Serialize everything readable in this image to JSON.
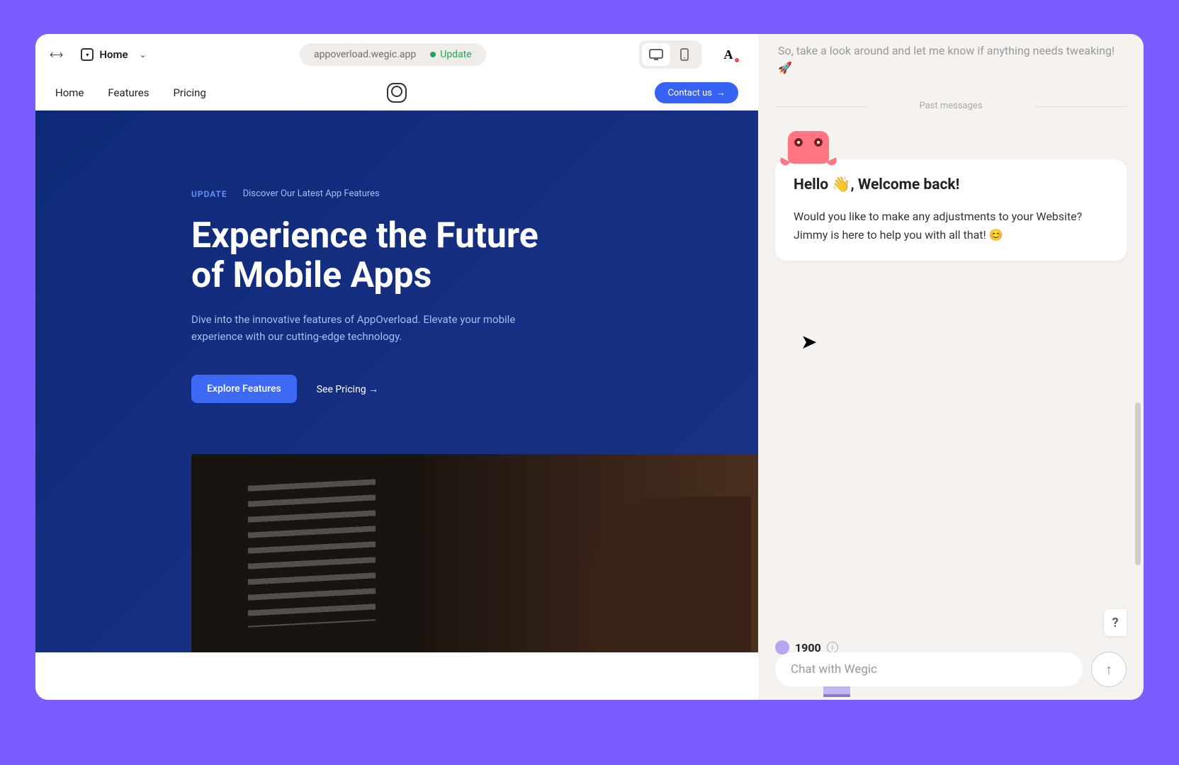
{
  "topbar": {
    "home_label": "Home",
    "url": "appoverload.wegic.app",
    "update_label": "Update"
  },
  "site_nav": {
    "items": [
      "Home",
      "Features",
      "Pricing"
    ],
    "contact_label": "Contact us",
    "contact_arrow": "→"
  },
  "hero": {
    "badge": "UPDATE",
    "badge_sub": "Discover Our Latest App Features",
    "headline": "Experience the Future of Mobile Apps",
    "description": "Dive into the innovative features of AppOverload. Elevate your mobile experience with our cutting-edge technology.",
    "primary_cta": "Explore Features",
    "secondary_cta": "See Pricing →"
  },
  "chat": {
    "faded": "So, take a look around and let me know if anything needs tweaking! 🚀",
    "divider_label": "Past messages",
    "greeting": "Hello 👋, Welcome back!",
    "body": "Would you like to make any adjustments to your Website? Jimmy is here to help you with all that! 😊",
    "credits_value": "1900",
    "input_placeholder": "Chat with Wegic",
    "help_label": "?"
  }
}
